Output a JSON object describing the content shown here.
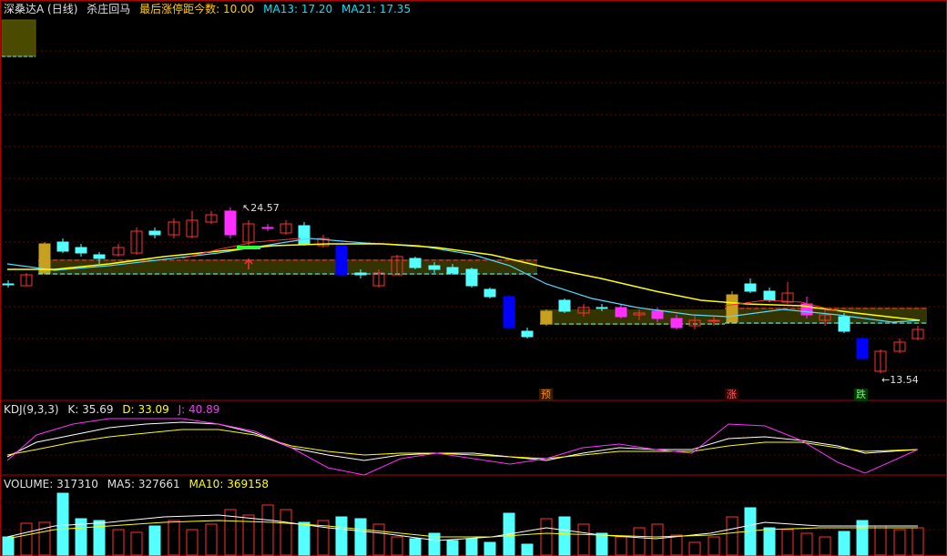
{
  "main_panel": {
    "title": "深桑达A (日线)",
    "indicator": "杀庄回马",
    "last_limit_days_label": "最后涨停距今数:",
    "last_limit_days_value": "10.00",
    "ma13_label": "MA13:",
    "ma13_value": "17.20",
    "ma21_label": "MA21:",
    "ma21_value": "17.35",
    "high_label": "24.57",
    "low_label": "13.54",
    "signals": [
      "预",
      "涨",
      "跌"
    ]
  },
  "kdj_panel": {
    "title": "KDJ(9,3,3)",
    "k_label": "K:",
    "k_value": "35.69",
    "d_label": "D:",
    "d_value": "33.09",
    "j_label": "J:",
    "j_value": "40.89"
  },
  "volume_panel": {
    "title": "VOLUME:",
    "volume_value": "317310",
    "ma5_label": "MA5:",
    "ma5_value": "327661",
    "ma10_label": "MA10:",
    "ma10_value": "369158"
  },
  "colors": {
    "up": "#ff3030",
    "down": "#54ffff",
    "ma13": "#54d8ff",
    "ma21": "#ffff00",
    "magenta": "#ff30ff",
    "blue": "#0000ff"
  }
}
